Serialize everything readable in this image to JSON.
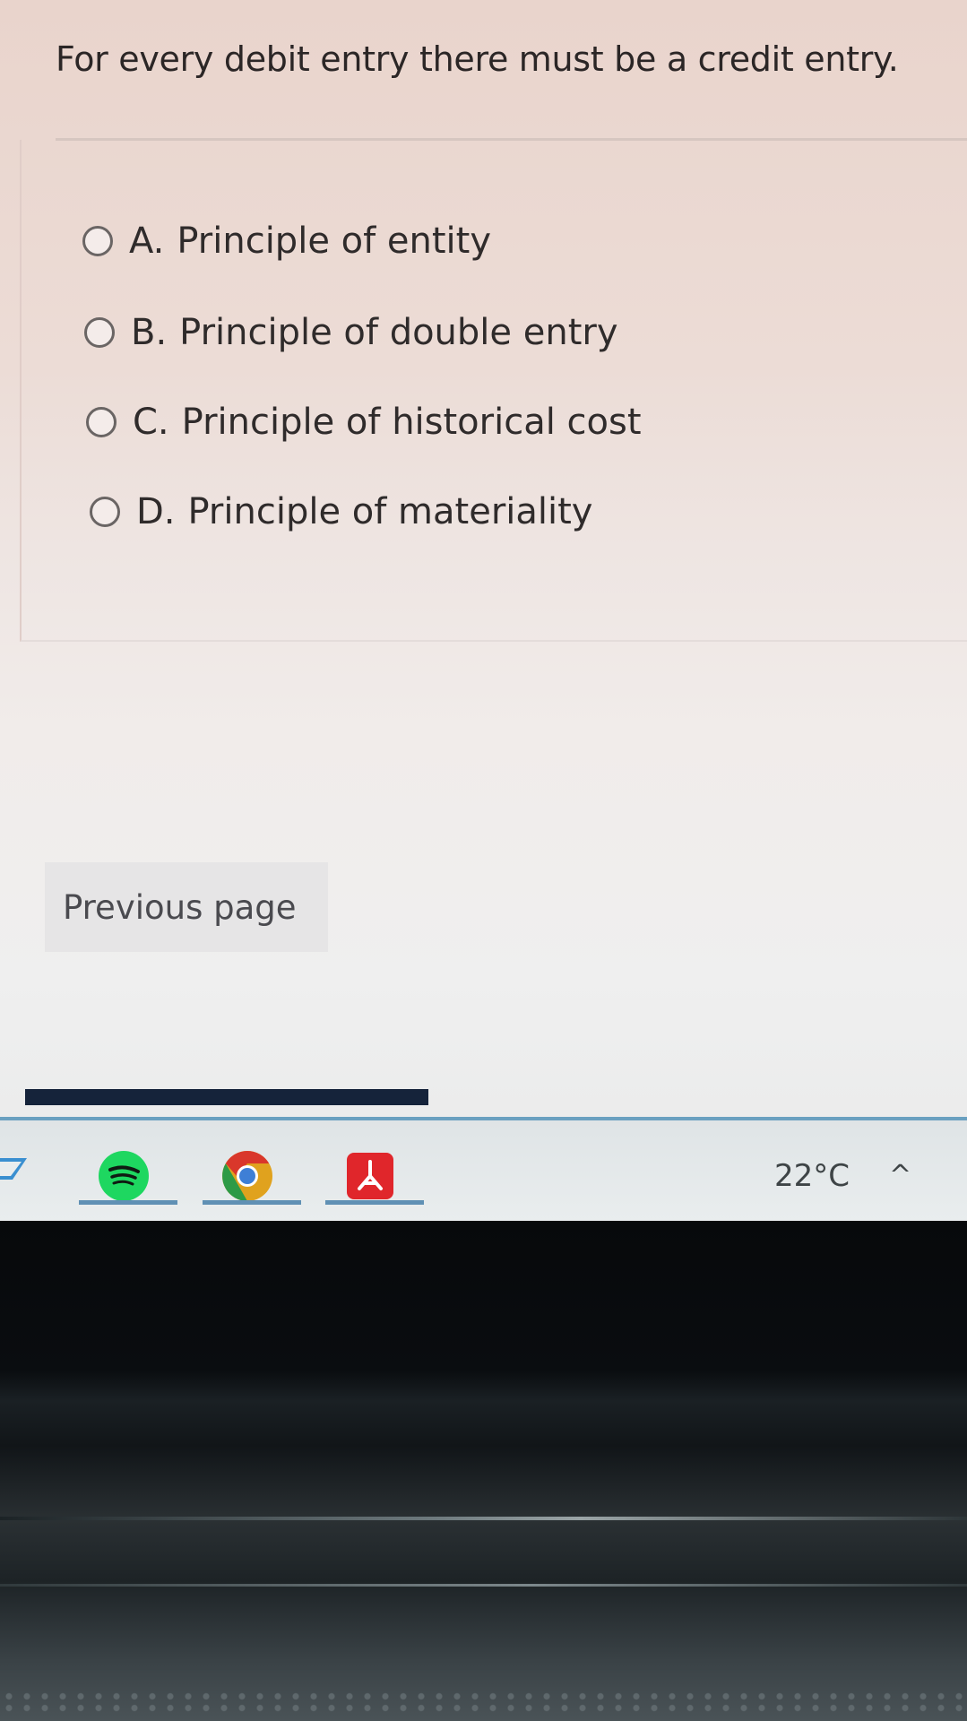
{
  "question": {
    "text": "For every debit entry there must be a credit entry."
  },
  "options": [
    {
      "letter": "A.",
      "label": "Principle of entity"
    },
    {
      "letter": "B.",
      "label": "Principle of double entry"
    },
    {
      "letter": "C.",
      "label": "Principle of historical cost"
    },
    {
      "letter": "D.",
      "label": "Principle of materiality"
    }
  ],
  "navigation": {
    "previous_label": "Previous page"
  },
  "taskbar": {
    "apps": [
      "spotify-icon",
      "chrome-icon",
      "acrobat-icon"
    ],
    "temperature": "22°C"
  },
  "colors": {
    "progress_bar": "#15233a",
    "taskbar_accent": "#5f90b4",
    "spotify": "#1ed760",
    "acrobat": "#e0262b"
  }
}
